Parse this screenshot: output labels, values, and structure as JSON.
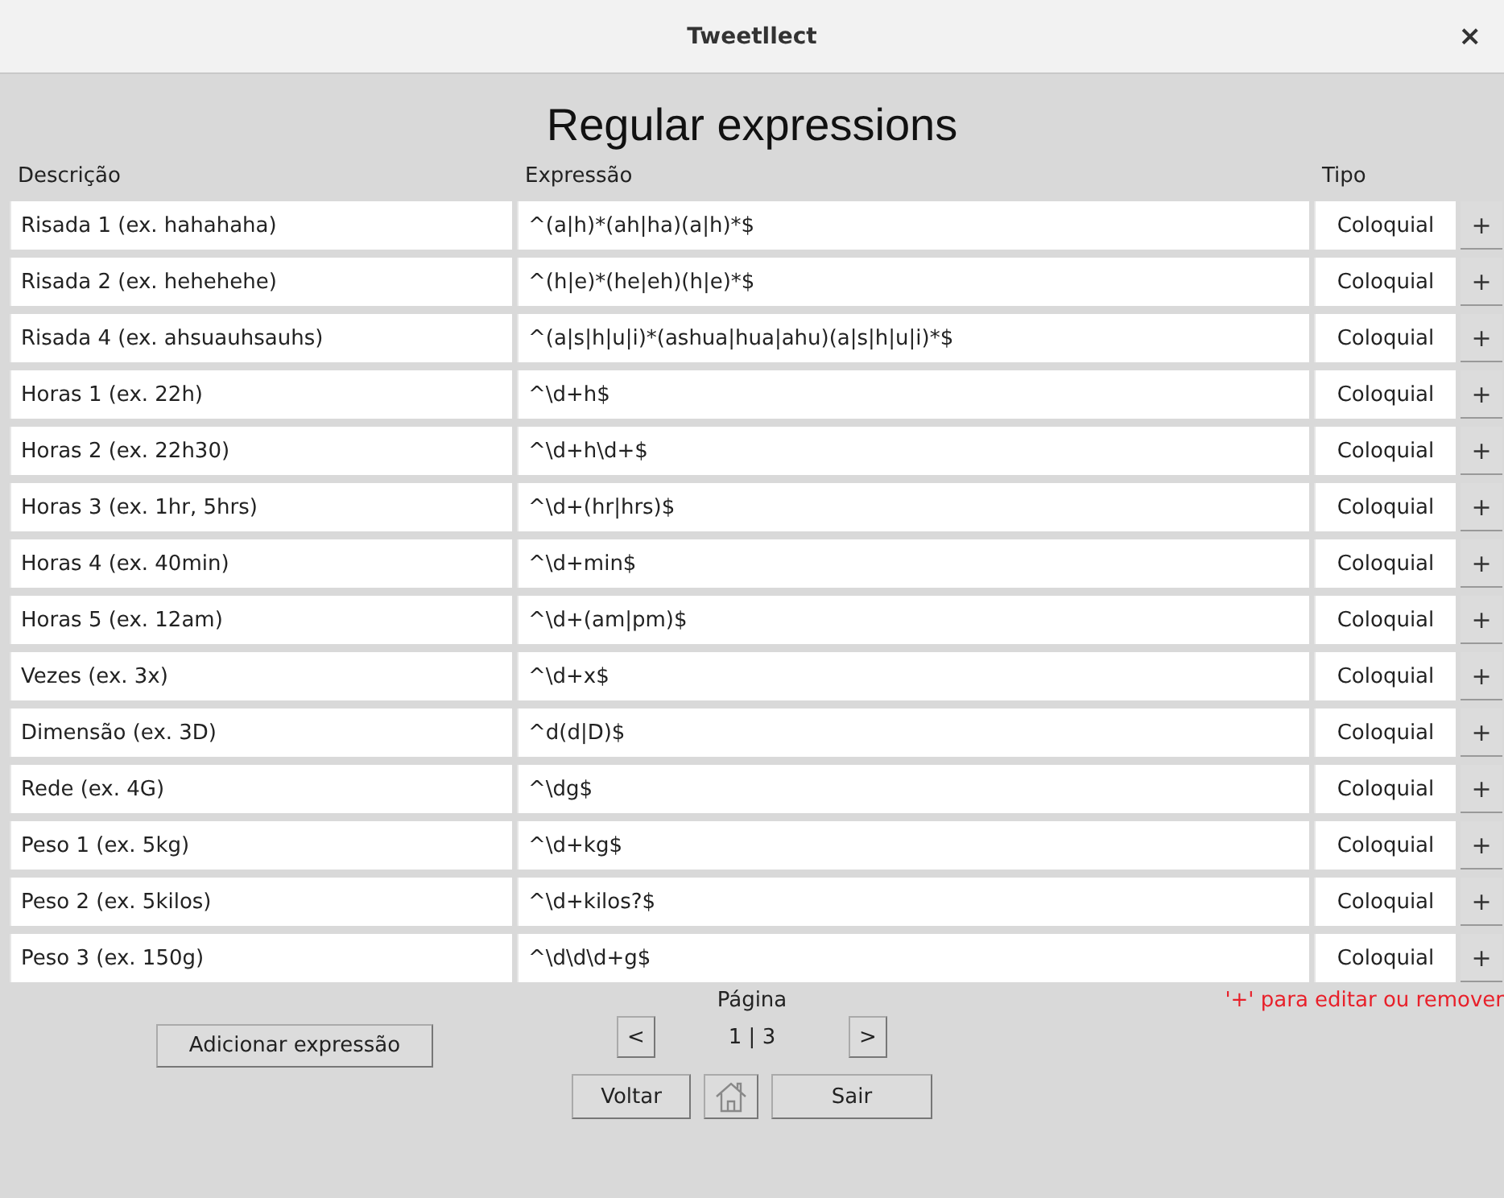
{
  "window": {
    "title": "Tweetllect",
    "close": "×"
  },
  "heading": "Regular expressions",
  "table": {
    "columns": [
      "Descrição",
      "Expressão",
      "Tipo"
    ],
    "rows": [
      {
        "description": "Risada 1 (ex. hahahaha)",
        "expression": "^(a|h)*(ah|ha)(a|h)*$",
        "type": "Coloquial",
        "action": "+"
      },
      {
        "description": "Risada 2 (ex. hehehehe)",
        "expression": "^(h|e)*(he|eh)(h|e)*$",
        "type": "Coloquial",
        "action": "+"
      },
      {
        "description": "Risada 4 (ex. ahsuauhsauhs)",
        "expression": "^(a|s|h|u|i)*(ashua|hua|ahu)(a|s|h|u|i)*$",
        "type": "Coloquial",
        "action": "+"
      },
      {
        "description": "Horas 1 (ex. 22h)",
        "expression": "^\\d+h$",
        "type": "Coloquial",
        "action": "+"
      },
      {
        "description": "Horas 2 (ex. 22h30)",
        "expression": "^\\d+h\\d+$",
        "type": "Coloquial",
        "action": "+"
      },
      {
        "description": "Horas 3 (ex. 1hr, 5hrs)",
        "expression": "^\\d+(hr|hrs)$",
        "type": "Coloquial",
        "action": "+"
      },
      {
        "description": "Horas 4 (ex. 40min)",
        "expression": "^\\d+min$",
        "type": "Coloquial",
        "action": "+"
      },
      {
        "description": "Horas 5 (ex. 12am)",
        "expression": "^\\d+(am|pm)$",
        "type": "Coloquial",
        "action": "+"
      },
      {
        "description": "Vezes (ex. 3x)",
        "expression": "^\\d+x$",
        "type": "Coloquial",
        "action": "+"
      },
      {
        "description": "Dimensão (ex. 3D)",
        "expression": "^d(d|D)$",
        "type": "Coloquial",
        "action": "+"
      },
      {
        "description": "Rede (ex. 4G)",
        "expression": "^\\dg$",
        "type": "Coloquial",
        "action": "+"
      },
      {
        "description": "Peso 1 (ex. 5kg)",
        "expression": "^\\d+kg$",
        "type": "Coloquial",
        "action": "+"
      },
      {
        "description": "Peso 2 (ex. 5kilos)",
        "expression": "^\\d+kilos?$",
        "type": "Coloquial",
        "action": "+"
      },
      {
        "description": "Peso 3 (ex. 150g)",
        "expression": "^\\d\\d\\d+g$",
        "type": "Coloquial",
        "action": "+"
      }
    ]
  },
  "add_button": "Adicionar expressão",
  "pagination": {
    "label": "Página",
    "prev": "<",
    "page": "1 | 3",
    "next": ">"
  },
  "hint": "'+' para editar ou remover",
  "footer": {
    "back": "Voltar",
    "exit": "Sair"
  }
}
